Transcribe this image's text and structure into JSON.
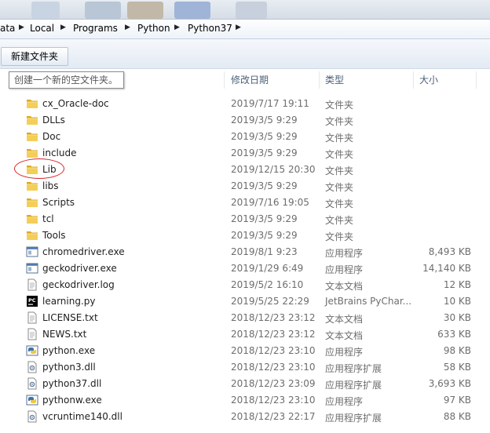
{
  "breadcrumb": {
    "items": [
      "ata",
      "Local",
      "Programs",
      "Python",
      "Python37"
    ]
  },
  "toolbar": {
    "new_folder_label": "新建文件夹"
  },
  "tooltip": {
    "text": "创建一个新的空文件夹。"
  },
  "columns": {
    "name": "",
    "date": "修改日期",
    "type": "类型",
    "size": "大小"
  },
  "files": [
    {
      "name": "cx_Oracle-doc",
      "date": "2019/7/17 19:11",
      "type": "文件夹",
      "size": "",
      "icon": "folder-icon"
    },
    {
      "name": "DLLs",
      "date": "2019/3/5 9:29",
      "type": "文件夹",
      "size": "",
      "icon": "folder-icon"
    },
    {
      "name": "Doc",
      "date": "2019/3/5 9:29",
      "type": "文件夹",
      "size": "",
      "icon": "folder-icon"
    },
    {
      "name": "include",
      "date": "2019/3/5 9:29",
      "type": "文件夹",
      "size": "",
      "icon": "folder-icon"
    },
    {
      "name": "Lib",
      "date": "2019/12/15 20:30",
      "type": "文件夹",
      "size": "",
      "icon": "folder-icon"
    },
    {
      "name": "libs",
      "date": "2019/3/5 9:29",
      "type": "文件夹",
      "size": "",
      "icon": "folder-icon"
    },
    {
      "name": "Scripts",
      "date": "2019/7/16 19:05",
      "type": "文件夹",
      "size": "",
      "icon": "folder-icon"
    },
    {
      "name": "tcl",
      "date": "2019/3/5 9:29",
      "type": "文件夹",
      "size": "",
      "icon": "folder-icon"
    },
    {
      "name": "Tools",
      "date": "2019/3/5 9:29",
      "type": "文件夹",
      "size": "",
      "icon": "folder-icon"
    },
    {
      "name": "chromedriver.exe",
      "date": "2019/8/1 9:23",
      "type": "应用程序",
      "size": "8,493 KB",
      "icon": "exe-icon"
    },
    {
      "name": "geckodriver.exe",
      "date": "2019/1/29 6:49",
      "type": "应用程序",
      "size": "14,140 KB",
      "icon": "exe-icon"
    },
    {
      "name": "geckodriver.log",
      "date": "2019/5/2 16:10",
      "type": "文本文档",
      "size": "12 KB",
      "icon": "text-file-icon"
    },
    {
      "name": "learning.py",
      "date": "2019/5/25 22:29",
      "type": "JetBrains PyChar...",
      "size": "10 KB",
      "icon": "pycharm-icon"
    },
    {
      "name": "LICENSE.txt",
      "date": "2018/12/23 23:12",
      "type": "文本文档",
      "size": "30 KB",
      "icon": "text-file-icon"
    },
    {
      "name": "NEWS.txt",
      "date": "2018/12/23 23:12",
      "type": "文本文档",
      "size": "633 KB",
      "icon": "text-file-icon"
    },
    {
      "name": "python.exe",
      "date": "2018/12/23 23:10",
      "type": "应用程序",
      "size": "98 KB",
      "icon": "python-icon"
    },
    {
      "name": "python3.dll",
      "date": "2018/12/23 23:10",
      "type": "应用程序扩展",
      "size": "58 KB",
      "icon": "dll-icon"
    },
    {
      "name": "python37.dll",
      "date": "2018/12/23 23:09",
      "type": "应用程序扩展",
      "size": "3,693 KB",
      "icon": "dll-icon"
    },
    {
      "name": "pythonw.exe",
      "date": "2018/12/23 23:10",
      "type": "应用程序",
      "size": "97 KB",
      "icon": "python-icon"
    },
    {
      "name": "vcruntime140.dll",
      "date": "2018/12/23 22:17",
      "type": "应用程序扩展",
      "size": "88 KB",
      "icon": "dll-icon"
    }
  ],
  "colors": {
    "folder": "#e8b830",
    "highlight_circle": "#d9242a",
    "header_text": "#4c607a"
  }
}
